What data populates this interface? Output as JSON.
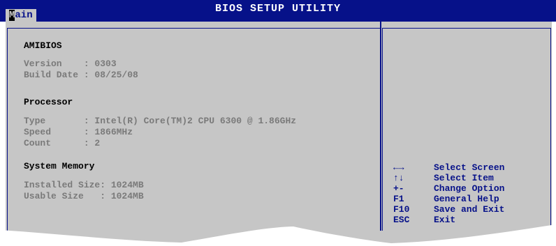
{
  "header": {
    "title": "BIOS SETUP UTILITY",
    "tab_main": {
      "first": "M",
      "rest": "ain"
    }
  },
  "amibios": {
    "heading": "AMIBIOS",
    "version_line": "Version    : 0303",
    "build_line": "Build Date : 08/25/08"
  },
  "processor": {
    "heading": "Processor",
    "type_line": "Type       : Intel(R) Core(TM)2 CPU 6300 @ 1.86GHz",
    "speed_line": "Speed      : 1866MHz",
    "count_line": "Count      : 2"
  },
  "memory": {
    "heading": "System Memory",
    "installed_line": "Installed Size: 1024MB",
    "usable_line": "Usable Size   : 1024MB"
  },
  "help": {
    "items": [
      {
        "key": "←→",
        "desc": "Select Screen",
        "icon": "left-right-arrows-icon"
      },
      {
        "key": "↑↓",
        "desc": "Select Item",
        "icon": "up-down-arrows-icon"
      },
      {
        "key": "+-",
        "desc": "Change Option"
      },
      {
        "key": "F1",
        "desc": "General Help"
      },
      {
        "key": "F10",
        "desc": "Save and Exit"
      },
      {
        "key": "ESC",
        "desc": "Exit"
      }
    ]
  },
  "colors": {
    "bios_blue": "#061189",
    "panel_gray": "#c6c6c6",
    "value_gray": "#7a7a7a"
  }
}
